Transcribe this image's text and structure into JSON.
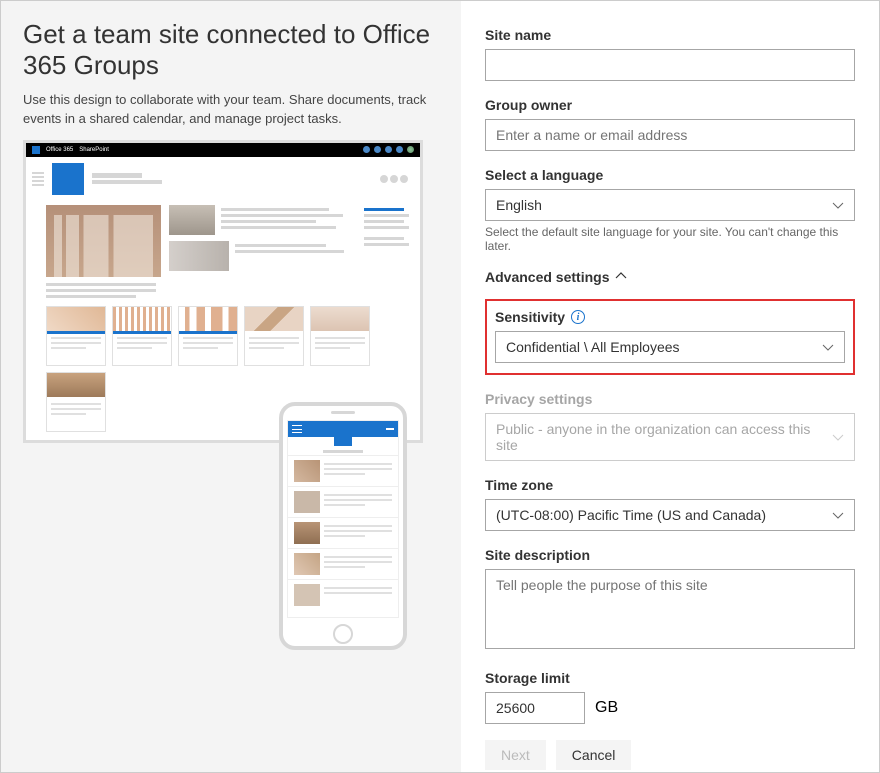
{
  "left": {
    "title": "Get a team site connected to Office 365 Groups",
    "description": "Use this design to collaborate with your team. Share documents, track events in a shared calendar, and manage project tasks.",
    "preview": {
      "office_label": "Office 365",
      "sharepoint_label": "SharePoint"
    }
  },
  "form": {
    "site_name": {
      "label": "Site name",
      "value": ""
    },
    "group_owner": {
      "label": "Group owner",
      "placeholder": "Enter a name or email address",
      "value": ""
    },
    "language": {
      "label": "Select a language",
      "value": "English",
      "help": "Select the default site language for your site. You can't change this later."
    },
    "advanced_label": "Advanced settings",
    "sensitivity": {
      "label": "Sensitivity",
      "value": "Confidential \\ All Employees"
    },
    "privacy": {
      "label": "Privacy settings",
      "value": "Public - anyone in the organization can access this site"
    },
    "timezone": {
      "label": "Time zone",
      "value": "(UTC-08:00) Pacific Time (US and Canada)"
    },
    "description": {
      "label": "Site description",
      "placeholder": "Tell people the purpose of this site",
      "value": ""
    },
    "storage": {
      "label": "Storage limit",
      "value": "25600",
      "unit": "GB"
    },
    "buttons": {
      "next": "Next",
      "cancel": "Cancel"
    }
  }
}
